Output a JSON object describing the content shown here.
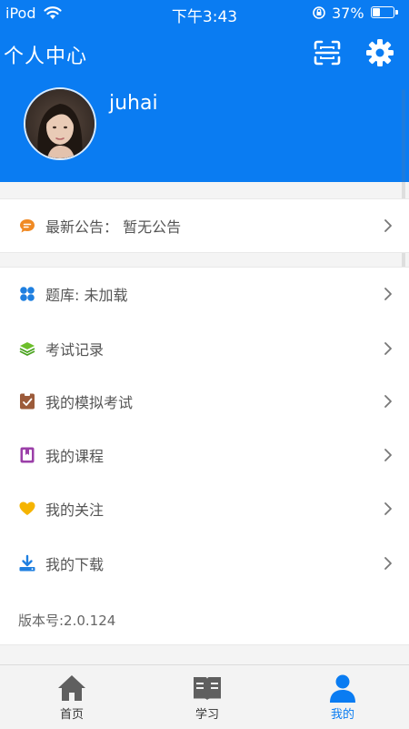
{
  "status_bar": {
    "carrier": "iPod",
    "time": "下午3:43",
    "battery": "37%",
    "battery_level": 0.37
  },
  "header": {
    "title": "个人中心",
    "username": "juhai",
    "scan_icon": "scan-icon",
    "settings_icon": "gear-icon"
  },
  "notice": {
    "label": "最新公告：  暂无公告",
    "icon": "message-icon"
  },
  "menu": {
    "items": [
      {
        "label": "题库: 未加载",
        "icon": "grid-icon"
      },
      {
        "label": "考试记录",
        "icon": "stack-icon"
      },
      {
        "label": "我的模拟考试",
        "icon": "clipboard-check-icon"
      },
      {
        "label": "我的课程",
        "icon": "bookmark-book-icon"
      },
      {
        "label": "我的关注",
        "icon": "heart-icon"
      },
      {
        "label": "我的下载",
        "icon": "download-icon"
      }
    ],
    "version": "版本号:2.0.124"
  },
  "tabbar": {
    "tabs": [
      {
        "label": "首页",
        "icon": "home-icon",
        "active": false
      },
      {
        "label": "学习",
        "icon": "book-icon",
        "active": false
      },
      {
        "label": "我的",
        "icon": "user-icon",
        "active": true
      }
    ]
  },
  "colors": {
    "primary": "#0a7cf2",
    "background": "#f4f4f4",
    "text": "#555555"
  }
}
